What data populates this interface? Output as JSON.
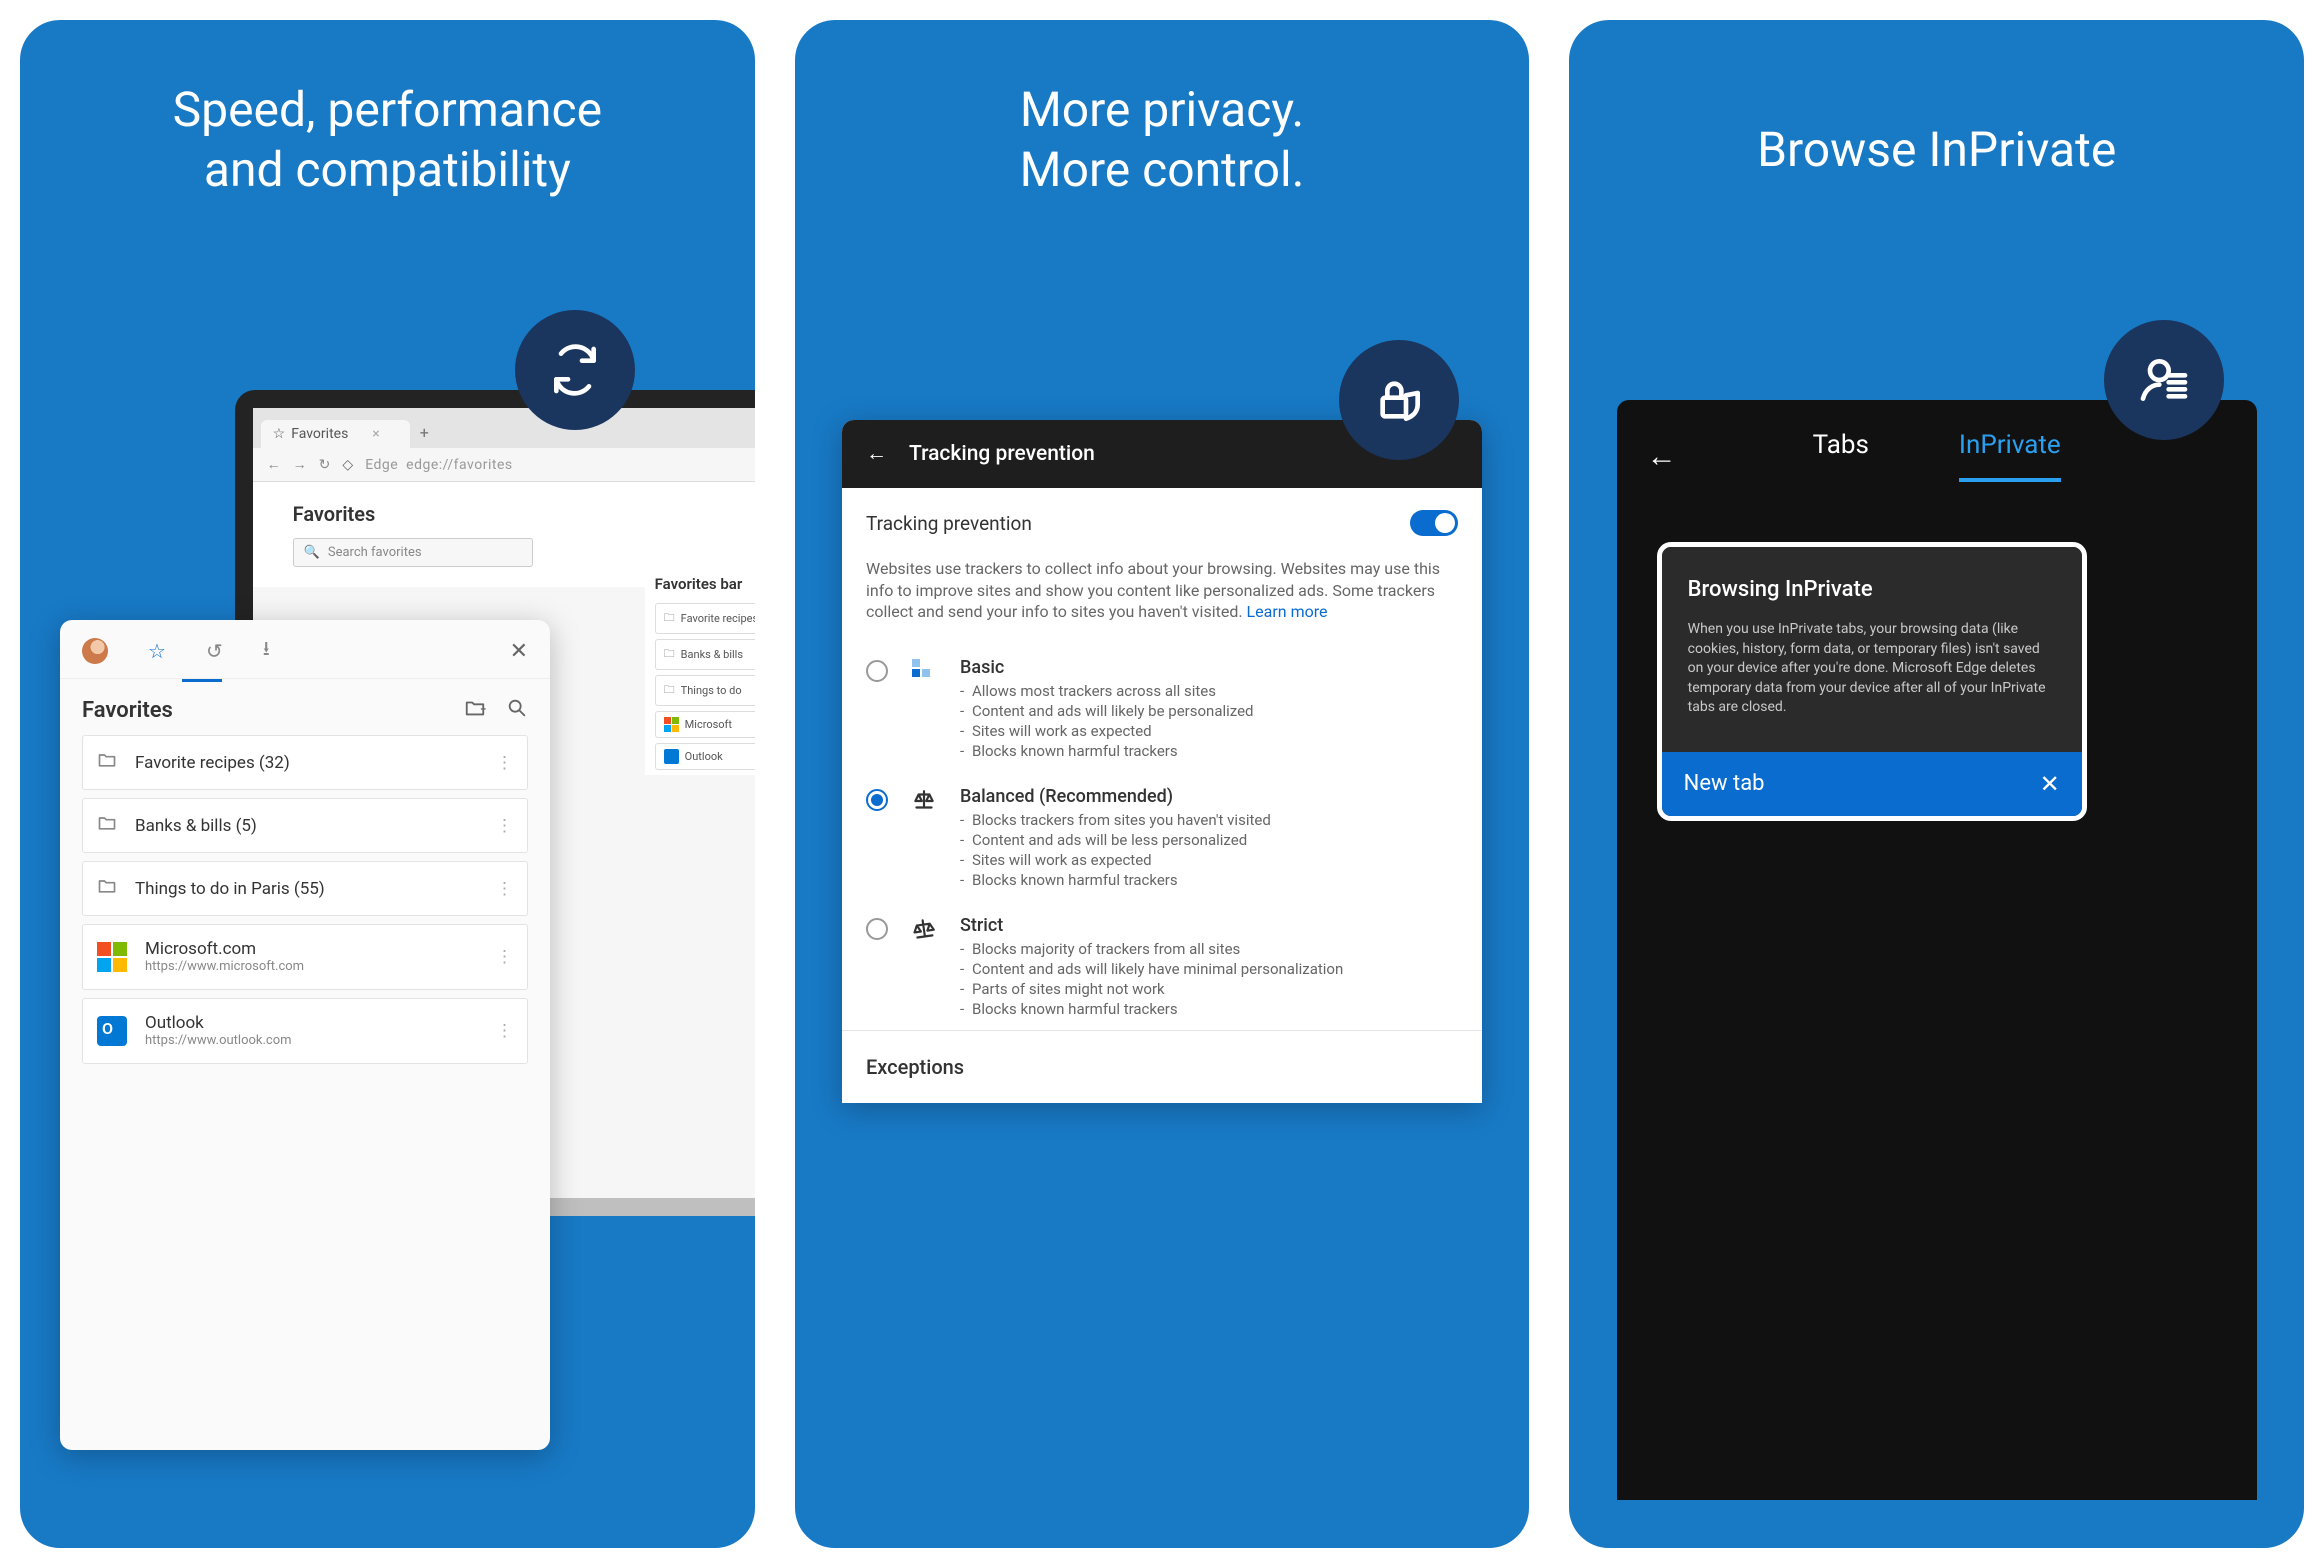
{
  "card1": {
    "title": "Speed, performance\nand compatibility",
    "desktop": {
      "tab_label": "Favorites",
      "address_label": "Edge",
      "address_url": "edge://favorites",
      "heading": "Favorites",
      "search_placeholder": "Search favorites",
      "bookmarks_heading": "Favorites bar",
      "bookmarks": [
        "Favorite recipes",
        "Banks & bills",
        "Things to do",
        "Microsoft",
        "Outlook"
      ]
    },
    "mobile": {
      "heading": "Favorites",
      "items": [
        {
          "label": "Favorite recipes (32)"
        },
        {
          "label": "Banks & bills (5)"
        },
        {
          "label": "Things to do in Paris (55)"
        },
        {
          "label": "Microsoft.com",
          "url": "https://www.microsoft.com"
        },
        {
          "label": "Outlook",
          "url": "https://www.outlook.com"
        }
      ]
    }
  },
  "card2": {
    "title": "More privacy.\nMore control.",
    "appbar": "Tracking prevention",
    "toggle_label": "Tracking prevention",
    "toggle_on": true,
    "description": "Websites use trackers to collect info about your browsing. Websites may use this info to improve sites and show you content like personalized ads. Some trackers collect and send your info to sites you haven't visited.",
    "learn_more": "Learn more",
    "options": [
      {
        "id": "basic",
        "title": "Basic",
        "selected": false,
        "bullets": [
          "Allows most trackers across all sites",
          "Content and ads will likely be personalized",
          "Sites will work as expected",
          "Blocks known harmful trackers"
        ]
      },
      {
        "id": "balanced",
        "title": "Balanced (Recommended)",
        "selected": true,
        "bullets": [
          "Blocks trackers from sites you haven't visited",
          "Content and ads will be less personalized",
          "Sites will work as expected",
          "Blocks known harmful trackers"
        ]
      },
      {
        "id": "strict",
        "title": "Strict",
        "selected": false,
        "bullets": [
          "Blocks majority of trackers from all sites",
          "Content and ads will likely have minimal personalization",
          "Parts of sites might not work",
          "Blocks known harmful trackers"
        ]
      }
    ],
    "exceptions": "Exceptions"
  },
  "card3": {
    "title": "Browse InPrivate",
    "tabs_label": "Tabs",
    "inprivate_label": "InPrivate",
    "thumb_title": "Browsing InPrivate",
    "thumb_text": "When you use InPrivate tabs, your browsing data (like cookies, history, form data, or temporary files) isn't saved on your device after you're done. Microsoft Edge deletes temporary data from your device after all of your InPrivate tabs are closed.",
    "new_tab": "New tab"
  }
}
